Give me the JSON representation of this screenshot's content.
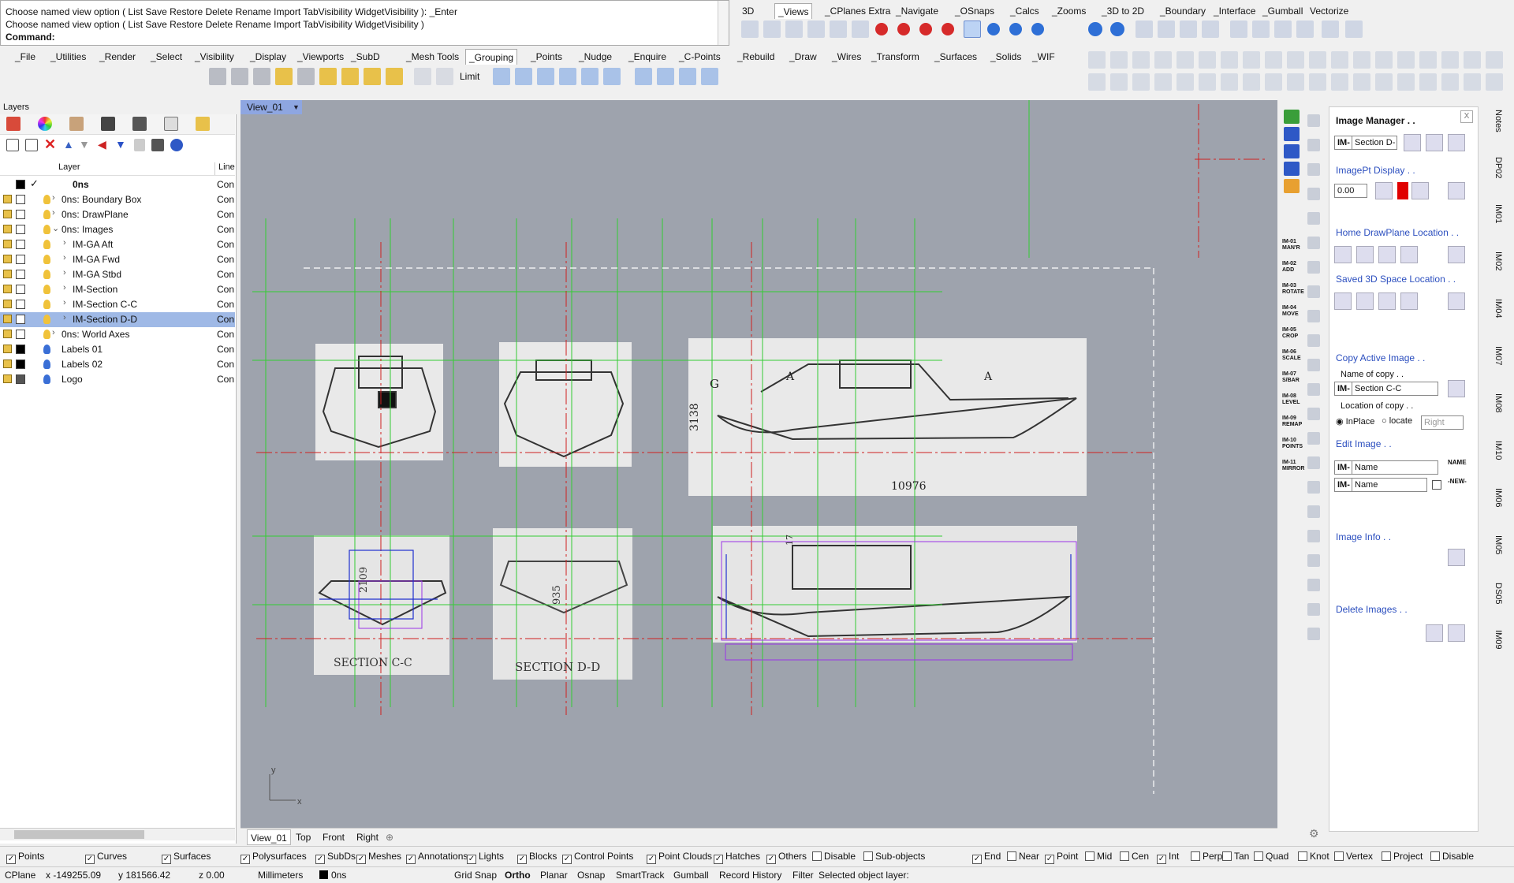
{
  "command": {
    "line1": "Choose named view option ( List  Save  Restore  Delete  Rename  Import  TabVisibility  WidgetVisibility ): _Enter",
    "line2": "Choose named view option ( List  Save  Restore  Delete  Rename  Import  TabVisibility  WidgetVisibility )",
    "prompt": "Command:"
  },
  "toolbar_tabs_top": [
    "3D",
    "_Views",
    "_CPlanes Extra",
    "_Navigate",
    "_OSnaps",
    "_Calcs",
    "_Zooms",
    "_3D to 2D",
    "_Boundary",
    "_Interface",
    "_Gumball",
    "Vectorize"
  ],
  "toolbar_tabs_main": [
    "_File",
    "_Utilities",
    "_Render",
    "_Select",
    "_Visibility",
    "_Display",
    "_Viewports",
    "_SubD",
    "_Mesh Tools",
    "_Grouping",
    "_Points",
    "_Nudge",
    "_Enquire",
    "_C-Points",
    "_Rebuild",
    "_Draw",
    "_Wires",
    "_Transform",
    "_Surfaces",
    "_Solids",
    "_WIF"
  ],
  "toolbar_limit_label": "Limit",
  "layers": {
    "title": "Layers",
    "col_layer": "Layer",
    "col_line": "Line",
    "rows": [
      {
        "name": "0ns",
        "indent": 0,
        "line": "Con",
        "current": true,
        "color": "#000000",
        "bulb": "none",
        "expander": ""
      },
      {
        "name": "0ns: Boundary Box",
        "indent": 1,
        "line": "Con",
        "color": "#ffffff",
        "bulb": "yellow",
        "expander": ">"
      },
      {
        "name": "0ns: DrawPlane",
        "indent": 1,
        "line": "Con",
        "color": "#ffffff",
        "bulb": "yellow",
        "expander": ">"
      },
      {
        "name": "0ns: Images",
        "indent": 1,
        "line": "Con",
        "color": "#ffffff",
        "bulb": "yellow",
        "expander": "v"
      },
      {
        "name": "IM-GA Aft",
        "indent": 2,
        "line": "Con",
        "color": "#ffffff",
        "bulb": "yellow",
        "expander": ">"
      },
      {
        "name": "IM-GA Fwd",
        "indent": 2,
        "line": "Con",
        "color": "#ffffff",
        "bulb": "yellow",
        "expander": ">"
      },
      {
        "name": "IM-GA Stbd",
        "indent": 2,
        "line": "Con",
        "color": "#ffffff",
        "bulb": "yellow",
        "expander": ">"
      },
      {
        "name": "IM-Section",
        "indent": 2,
        "line": "Con",
        "color": "#ffffff",
        "bulb": "yellow",
        "expander": ">"
      },
      {
        "name": "IM-Section C-C",
        "indent": 2,
        "line": "Con",
        "color": "#ffffff",
        "bulb": "yellow",
        "expander": ">"
      },
      {
        "name": "IM-Section D-D",
        "indent": 2,
        "line": "Con",
        "color": "#ffffff",
        "bulb": "yellow",
        "expander": ">",
        "selected": true
      },
      {
        "name": "0ns: World Axes",
        "indent": 1,
        "line": "Con",
        "color": "#ffffff",
        "bulb": "yellow",
        "expander": ">"
      },
      {
        "name": "Labels 01",
        "indent": 1,
        "line": "Con",
        "color": "#000000",
        "bulb": "blue",
        "expander": ""
      },
      {
        "name": "Labels 02",
        "indent": 1,
        "line": "Con",
        "color": "#000000",
        "bulb": "blue",
        "expander": ""
      },
      {
        "name": "Logo",
        "indent": 1,
        "line": "Con",
        "color": "#555555",
        "bulb": "blue",
        "expander": ""
      }
    ]
  },
  "viewport": {
    "title": "View_01",
    "tabs": [
      "View_01",
      "Top",
      "Front",
      "Right"
    ],
    "axis_x": "x",
    "axis_y": "y",
    "drawing_labels": {
      "g": "G",
      "height": "3138",
      "length": "10976",
      "a1": "A",
      "a2": "A",
      "sec_cc": "SECTION C-C",
      "sec_dd": "SECTION D-D",
      "dim_cc": "2109",
      "dim_dd": "935",
      "dim_17": "17"
    }
  },
  "image_manager": {
    "title": "Image Manager . .",
    "close": "X",
    "im_prefix": "IM-",
    "selected_image": "Section D-",
    "imagept_display": "ImagePt Display . .",
    "opacity_value": "0.00",
    "accent_color": "#e00000",
    "home_drawplane": "Home DrawPlane Location . .",
    "saved_3d": "Saved 3D Space Location . .",
    "copy_active": "Copy Active Image . .",
    "name_of_copy": "Name of copy . .",
    "copy_prefix": "IM-",
    "copy_name": "Section C-C",
    "location_of_copy": "Location of copy . .",
    "opt_inplace": "InPlace",
    "opt_locate": "locate",
    "locate_dir": "Right",
    "edit_image": "Edit Image . .",
    "edit_prefix1": "IM-",
    "edit_name1": "Name",
    "edit_label1": "NAME",
    "edit_prefix2": "IM-",
    "edit_name2": "Name",
    "edit_label2": "-NEW-",
    "image_info": "Image Info . .",
    "delete_images": "Delete Images . ."
  },
  "right_strip_labels": [
    "IM-01 MAN'R",
    "IM-02 ADD",
    "IM-03 ROTATE",
    "IM-04 MOVE",
    "IM-05 CROP",
    "IM-06 SCALE",
    "IM-07 S/BAR",
    "IM-08 LEVEL",
    "IM-09 REMAP",
    "IM-10 POINTS",
    "IM-11 MIRROR"
  ],
  "vertical_tabs": [
    "Notes",
    "DP02",
    "IM01",
    "IM02",
    "IM04",
    "IM07",
    "IM08",
    "IM10",
    "IM06",
    "IM05",
    "DS05",
    "IM09"
  ],
  "filter_checks": [
    {
      "label": "Points",
      "on": true
    },
    {
      "label": "Curves",
      "on": true
    },
    {
      "label": "Surfaces",
      "on": true
    },
    {
      "label": "Polysurfaces",
      "on": true
    },
    {
      "label": "SubDs",
      "on": true
    },
    {
      "label": "Meshes",
      "on": true
    },
    {
      "label": "Annotations",
      "on": true
    },
    {
      "label": "Lights",
      "on": true
    },
    {
      "label": "Blocks",
      "on": true
    },
    {
      "label": "Control Points",
      "on": true
    },
    {
      "label": "Point Clouds",
      "on": true
    },
    {
      "label": "Hatches",
      "on": true
    },
    {
      "label": "Others",
      "on": true
    },
    {
      "label": "Disable",
      "on": false
    },
    {
      "label": "Sub-objects",
      "on": false
    }
  ],
  "osnap_checks": [
    {
      "label": "End",
      "on": true
    },
    {
      "label": "Near",
      "on": false
    },
    {
      "label": "Point",
      "on": true
    },
    {
      "label": "Mid",
      "on": false
    },
    {
      "label": "Cen",
      "on": false
    },
    {
      "label": "Int",
      "on": true
    },
    {
      "label": "Perp",
      "on": false
    },
    {
      "label": "Tan",
      "on": false
    },
    {
      "label": "Quad",
      "on": false
    },
    {
      "label": "Knot",
      "on": false
    },
    {
      "label": "Vertex",
      "on": false
    },
    {
      "label": "Project",
      "on": false
    },
    {
      "label": "Disable",
      "on": false
    }
  ],
  "status": {
    "cplane": "CPlane",
    "x": "x -149255.09",
    "y": "y 181566.42",
    "z": "z 0.00",
    "units": "Millimeters",
    "layer": "0ns",
    "grid_snap": "Grid Snap",
    "ortho": "Ortho",
    "planar": "Planar",
    "osnap": "Osnap",
    "smarttrack": "SmartTrack",
    "gumball": "Gumball",
    "record_history": "Record History",
    "filter": "Filter",
    "message": "Selected object layer:"
  }
}
